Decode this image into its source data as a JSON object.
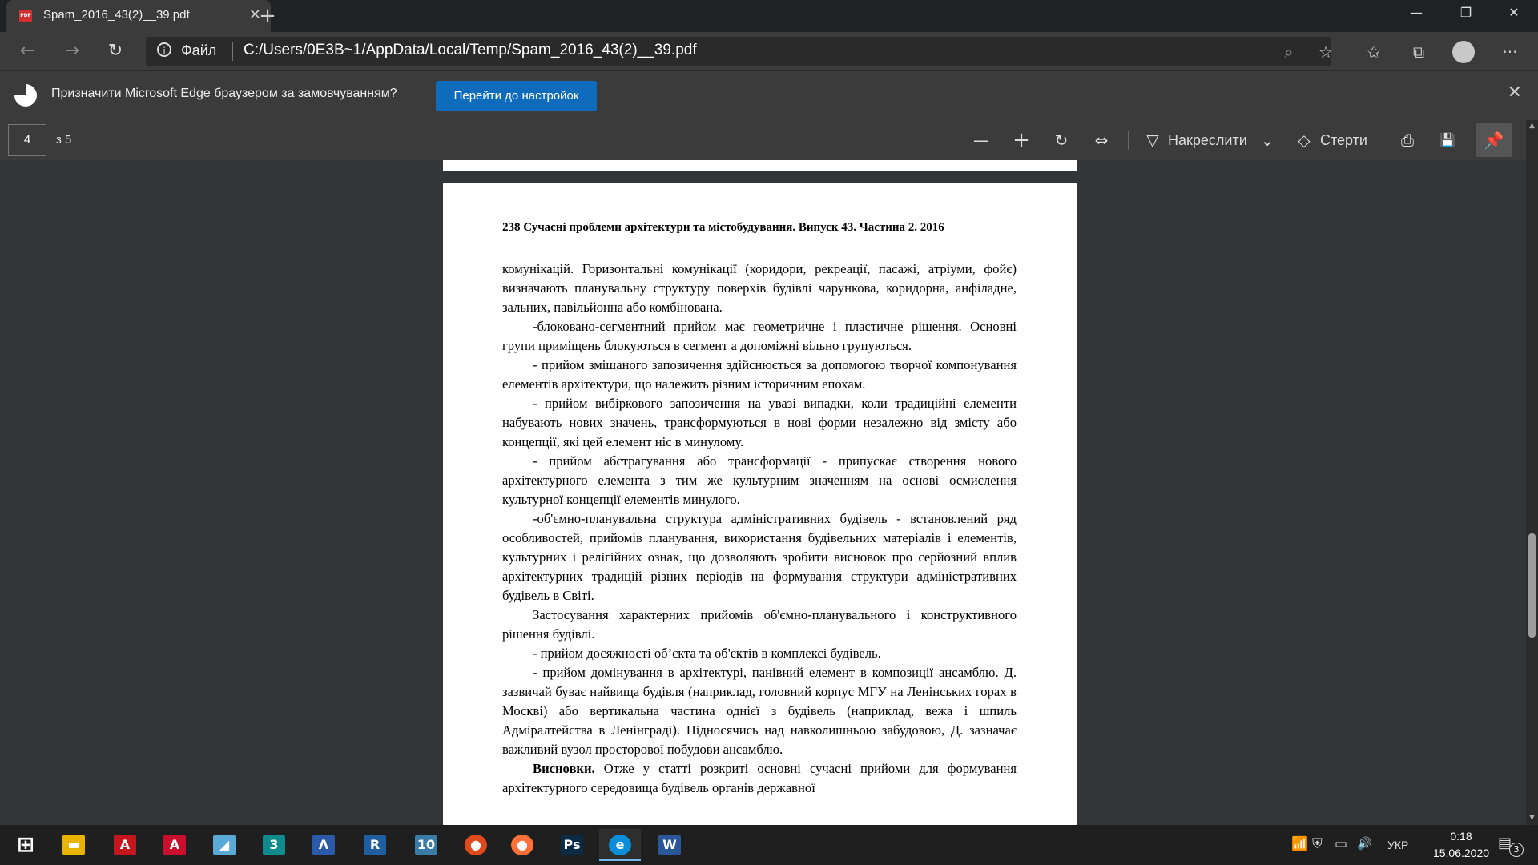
{
  "browser": {
    "tab_title": "Spam_2016_43(2)__39.pdf",
    "tab_icon": "pdf-file-icon",
    "tab_close": "✕",
    "new_tab": "+",
    "window_controls": {
      "minimize": "—",
      "maximize": "❐",
      "close": "✕"
    }
  },
  "address": {
    "back": "←",
    "forward": "→",
    "refresh": "↻",
    "info": "i",
    "scheme_label": "Файл",
    "url": "C:/Users/0E3B~1/AppData/Local/Temp/Spam_2016_43(2)__39.pdf",
    "zoom": "⌕",
    "favorite": "☆",
    "favorites": "✩",
    "collections": "⧉",
    "more": "···"
  },
  "banner": {
    "message": "Призначити Microsoft Edge браузером за замовчуванням?",
    "button": "Перейти до настройок",
    "close": "✕"
  },
  "pdf_toolbar": {
    "page_current": "4",
    "page_total": "з 5",
    "zoom_out": "—",
    "zoom_in": "+",
    "rotate": "↻",
    "fit": "⇔",
    "draw_label": "Накреслити",
    "draw_icon": "▽",
    "chevron": "⌄",
    "erase_label": "Стерти",
    "erase_icon": "◇",
    "print": "⎙",
    "save": "💾",
    "pin": "📌"
  },
  "document": {
    "running_head": "238    Сучасні проблеми архітектури та містобудування. Випуск 43. Частина 2. 2016",
    "paragraphs": [
      {
        "indent": false,
        "text": "комунікацій. Горизонтальні комунікації (коридори, рекреації, пасажі, атріуми, фойє) визначають планувальну структуру поверхів будівлі чарункова, коридорна, анфіладне, зальних, павільйонна або комбінована."
      },
      {
        "indent": true,
        "text": "-блоковано-сегментний прийом має геометричне і пластичне рішення. Основні групи приміщень блокуються в сегмент а допоміжні вільно групуються."
      },
      {
        "indent": true,
        "text": "- прийом змішаного запозичення здійснюється за допомогою творчої компонування елементів архітектури, що належить різним історичним епохам."
      },
      {
        "indent": true,
        "text": "- прийом вибіркового запозичення на увазі випадки, коли традиційні елементи набувають нових значень, трансформуються в нові форми незалежно від змісту або концепції, які цей елемент ніс в минулому."
      },
      {
        "indent": true,
        "text": "- прийом абстрагування або трансформації - припускає створення нового архітектурного елемента з тим же культурним значенням на основі осмислення культурної концепції елементів минулого."
      },
      {
        "indent": true,
        "text": "-об'ємно-планувальна структура адміністративних будівель - встановлений ряд особливостей, прийомів планування, використання будівельних матеріалів і елементів, культурних і релігійних ознак, що дозволяють зробити висновок про серйозний вплив архітектурних традицій різних періодів на формування структури адміністративних будівель в Світі."
      },
      {
        "indent": true,
        "text": "Застосування характерних прийомів об'ємно-планувального і конструктивного рішення будівлі."
      },
      {
        "indent": true,
        "text": "- прийом досяжності об’єкта та об'єктів в комплексі будівель."
      },
      {
        "indent": true,
        "text": "- прийом домінування в архітектурі, панівний елемент в композиції ансамблю. Д. зазвичай буває найвища будівля (наприклад, головний корпус МГУ на Ленінських горах в Москві) або вертикальна частина однієї з будівель (наприклад, вежа і шпиль Адміралтейства в Ленінграді). Підносячись над навколишньою забудовою, Д. зазначає важливий вузол просторової побудови ансамблю."
      }
    ],
    "conclusion_label": "Висновки.",
    "conclusion_text": " Отже у статті розкриті основні сучасні прийоми для формування архітектурного середовища будівель органів державної"
  },
  "taskbar": {
    "apps": [
      {
        "name": "start-icon",
        "glyph": "⊞",
        "color": "#1f1f1f"
      },
      {
        "name": "file-explorer-icon",
        "glyph": "▬",
        "color": "#e8b400"
      },
      {
        "name": "acrobat-icon",
        "glyph": "A",
        "color": "#c4161c"
      },
      {
        "name": "autocad-icon",
        "glyph": "A",
        "color": "#c8102e"
      },
      {
        "name": "sketch-tool-icon",
        "glyph": "◢",
        "color": "#5aa9d6"
      },
      {
        "name": "3ds-max-icon",
        "glyph": "3",
        "color": "#0f8b8d"
      },
      {
        "name": "archicad-icon",
        "glyph": "Λ",
        "color": "#2a5aa8"
      },
      {
        "name": "revit-icon",
        "glyph": "R",
        "color": "#1f5f9f"
      },
      {
        "name": "lumion-icon",
        "glyph": "10",
        "color": "#3a7ca5"
      },
      {
        "name": "paint-icon",
        "glyph": "●",
        "color": "#e04a1a"
      },
      {
        "name": "firefox-icon",
        "glyph": "●",
        "color": "#ff7139"
      },
      {
        "name": "photoshop-icon",
        "glyph": "Ps",
        "color": "#0b2a43"
      },
      {
        "name": "edge-icon",
        "glyph": "e",
        "color": "#0c8dd9"
      },
      {
        "name": "word-icon",
        "glyph": "W",
        "color": "#2b579a"
      }
    ],
    "tray": {
      "network": "📶",
      "security": "⛨",
      "battery": "▭",
      "volume": "🔊",
      "language": "УКР",
      "time": "0:18",
      "date": "15.06.2020",
      "notifications": "3"
    }
  }
}
